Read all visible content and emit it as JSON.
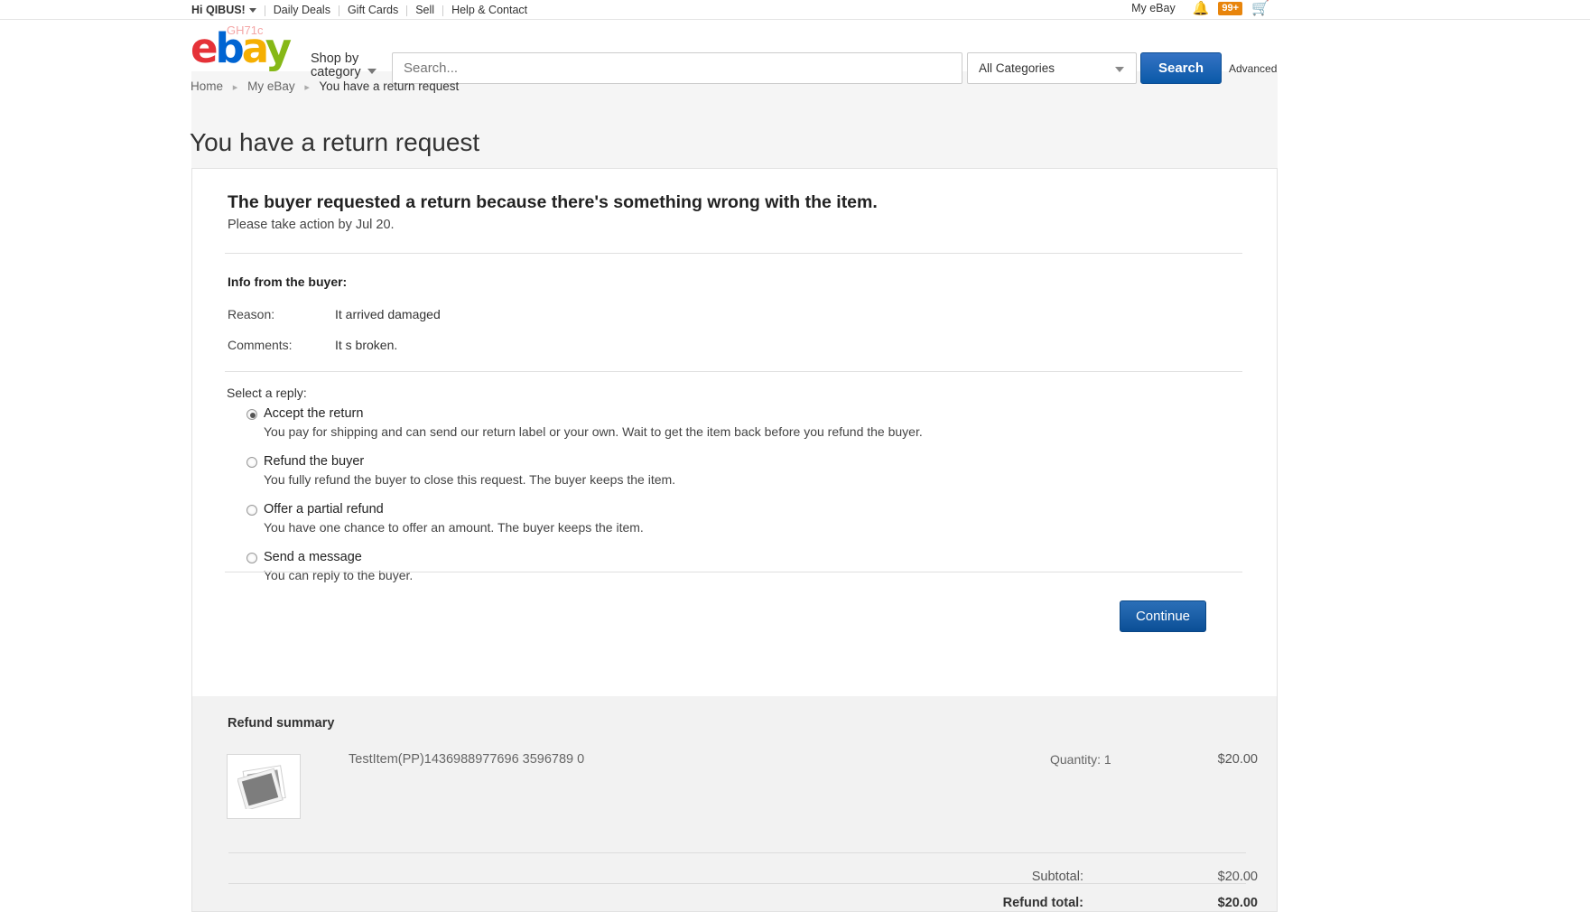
{
  "topbar": {
    "greeting": "Hi QIBUS!",
    "links": [
      "Daily Deals",
      "Gift Cards",
      "Sell",
      "Help & Contact"
    ],
    "my_ebay": "My eBay",
    "notification_count": "99+",
    "bell_icon": "bell-icon",
    "cart_icon": "cart-icon",
    "badge_color": "#e8850c"
  },
  "masthead": {
    "logo": {
      "e": "e",
      "b": "b",
      "a": "a",
      "y": "y"
    },
    "watermark": "GH71c",
    "shop_by_category": "Shop by\ncategory",
    "shop_by_line1": "Shop by",
    "shop_by_line2": "category",
    "search_placeholder": "Search...",
    "search_value": "",
    "category_selected": "All Categories",
    "search_button": "Search",
    "advanced_link": "Advanced",
    "accent_blue": "#0654ba"
  },
  "breadcrumb": {
    "items": [
      "Home",
      "My eBay",
      "You have a return request"
    ],
    "separator": "▸"
  },
  "page": {
    "title": "You have a return request"
  },
  "card": {
    "lead_title": "The buyer requested a return because there's something wrong with the item.",
    "lead_sub": "Please take action by Jul 20.",
    "info_heading": "Info from the buyer:",
    "reason_label": "Reason:",
    "reason_value": "It arrived damaged",
    "comments_label": "Comments:",
    "comments_value": "It s broken.",
    "select_reply_label": "Select a reply:",
    "options": [
      {
        "title": "Accept the return",
        "desc": "You pay for shipping and can send our return label or your own. Wait to get the item back before you refund the buyer.",
        "checked": true
      },
      {
        "title": "Refund the buyer",
        "desc": "You fully refund the buyer to close this request. The buyer keeps the item.",
        "checked": false
      },
      {
        "title": "Offer a partial refund",
        "desc": "You have one chance to offer an amount. The buyer keeps the item.",
        "checked": false
      },
      {
        "title": "Send a message",
        "desc": "You can reply to the buyer.",
        "checked": false
      }
    ],
    "continue_button": "Continue"
  },
  "summary": {
    "title": "Refund summary",
    "thumbnail_icon": "photo-placeholder-icon",
    "item_title": "TestItem(PP)1436988977696 3596789 0",
    "quantity": "Quantity: 1",
    "item_price": "$20.00",
    "subtotal_label": "Subtotal:",
    "subtotal_value": "$20.00",
    "total_label": "Refund total:",
    "total_value": "$20.00"
  }
}
